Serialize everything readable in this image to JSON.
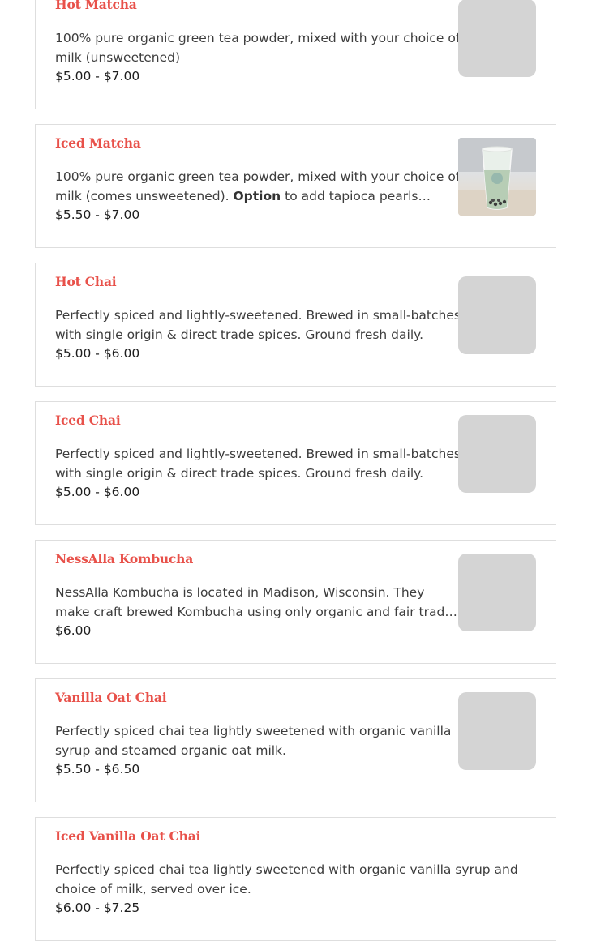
{
  "menu_items": [
    {
      "name": "Hot Matcha",
      "description": "100% pure organic green tea powder, mixed with your choice of milk (unsweetened)",
      "price": "$5.00 - $7.00"
    },
    {
      "name": "Iced Matcha",
      "description_before": "100% pure organic green tea powder, mixed with your choice of milk (comes unsweetened). ",
      "description_bold": "Option",
      "description_after": " to add tapioca pearls (boba) for an additional charge.",
      "price": "$5.50 - $7.00"
    },
    {
      "name": "Hot Chai",
      "description": "Perfectly spiced and lightly-sweetened. Brewed in small-batches with single origin & direct trade spices. Ground fresh daily.",
      "price": "$5.00 - $6.00"
    },
    {
      "name": "Iced Chai",
      "description": "Perfectly spiced and lightly-sweetened. Brewed in small-batches with single origin & direct trade spices. Ground fresh daily.",
      "price": "$5.00 - $6.00"
    },
    {
      "name": "NessAlla Kombucha",
      "description": "NessAlla Kombucha is located in Madison, Wisconsin. They make craft brewed Kombucha using only organic and fair trade ingredients.",
      "price": "$6.00"
    },
    {
      "name": "Vanilla Oat Chai",
      "description": "Perfectly spiced chai tea lightly sweetened with organic vanilla syrup and steamed organic oat milk.",
      "price": "$5.50 - $6.50"
    },
    {
      "name": "Iced Vanilla Oat Chai",
      "description": "Perfectly spiced chai tea lightly sweetened with organic vanilla syrup and choice of milk, served over ice.",
      "price": "$6.00 - $7.25"
    }
  ],
  "colors": {
    "title": "#e8514a",
    "description": "#3d3d3d",
    "price": "#1e1e1e",
    "card_border": "#dedede",
    "thumbnail_placeholder": "#d4d4d4"
  }
}
